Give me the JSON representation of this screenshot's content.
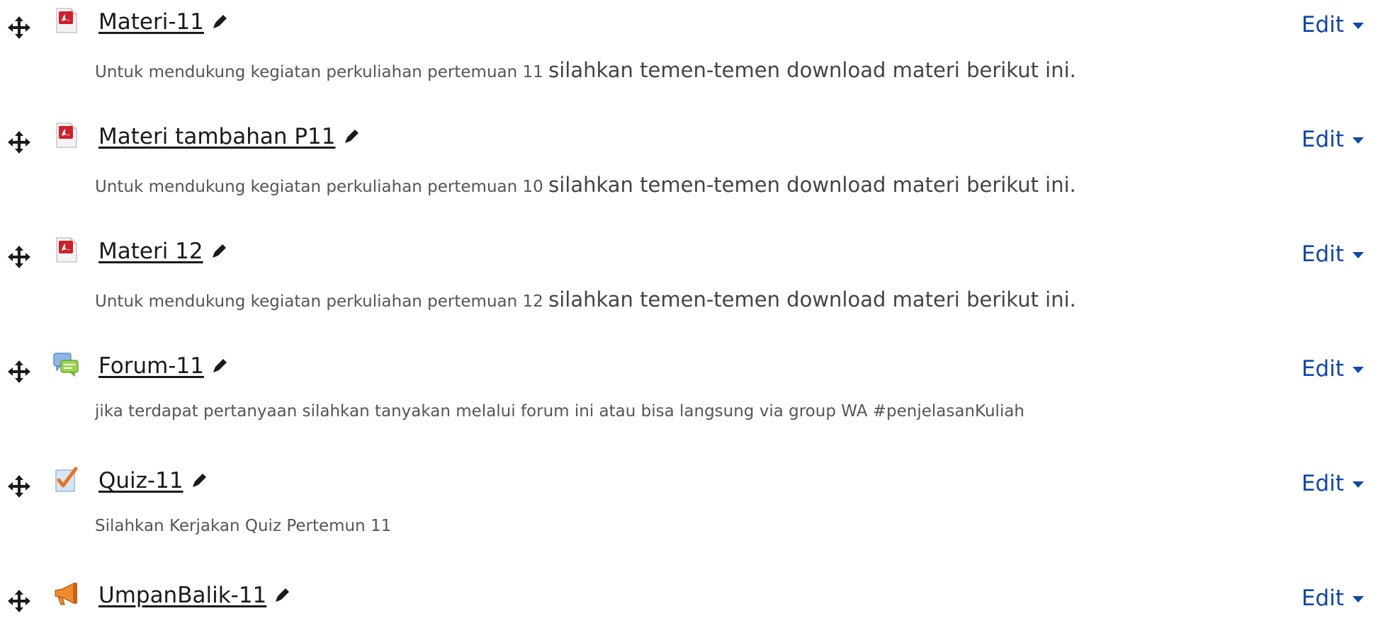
{
  "activities": [
    {
      "icon": "pdf-icon",
      "name": "Materi-11",
      "edit_label": "Edit",
      "desc_small": "Untuk mendukung kegiatan perkuliahan pertemuan 11",
      "desc_large": "silahkan temen-temen download materi berikut ini."
    },
    {
      "icon": "pdf-icon",
      "name": "Materi tambahan P11",
      "edit_label": "Edit",
      "desc_small": "Untuk mendukung kegiatan perkuliahan pertemuan 10",
      "desc_large": "silahkan temen-temen download materi berikut ini."
    },
    {
      "icon": "pdf-icon",
      "name": "Materi 12",
      "edit_label": "Edit",
      "desc_small": "Untuk mendukung kegiatan perkuliahan pertemuan 12",
      "desc_large": "silahkan temen-temen download materi berikut ini."
    },
    {
      "icon": "forum-icon",
      "name": "Forum-11",
      "edit_label": "Edit",
      "desc_small": "jika terdapat pertanyaan silahkan tanyakan melalui forum ini atau bisa langsung via group WA #penjelasanKuliah",
      "desc_large": ""
    },
    {
      "icon": "quiz-icon",
      "name": "Quiz-11",
      "edit_label": "Edit",
      "desc_small": "Silahkan Kerjakan Quiz Pertemun 11",
      "desc_large": ""
    },
    {
      "icon": "feedback-megaphone-icon",
      "name": "UmpanBalik-11",
      "edit_label": "Edit",
      "desc_small": "",
      "desc_large": ""
    }
  ],
  "colors": {
    "link": "#1a1a1a",
    "edit": "#0f47ad",
    "description": "#555555"
  }
}
